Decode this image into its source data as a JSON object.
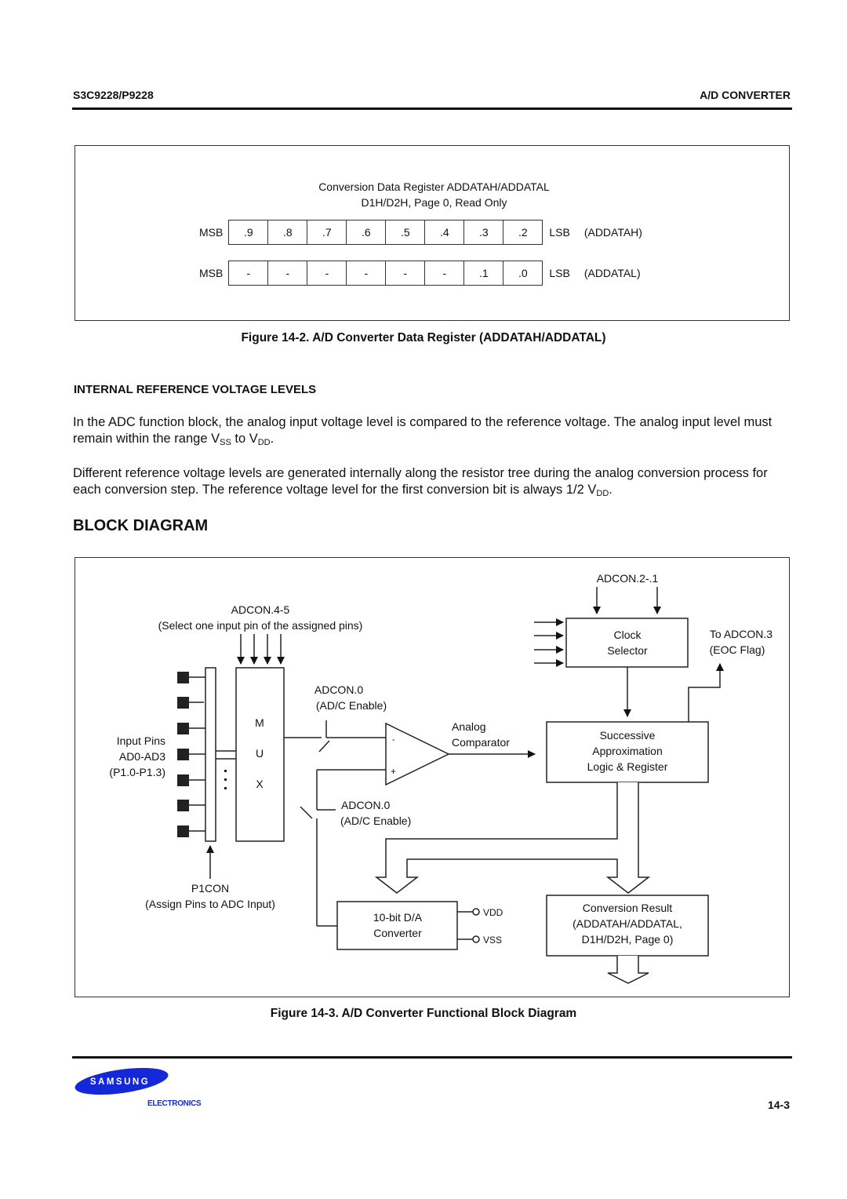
{
  "header": {
    "left": "S3C9228/P9228",
    "right": "A/D CONVERTER"
  },
  "figure_14_2": {
    "title_line1": "Conversion Data Register ADDATAH/ADDATAL",
    "title_line2": "D1H/D2H, Page 0, Read Only",
    "rows": [
      {
        "msb": "MSB",
        "bits": [
          ".9",
          ".8",
          ".7",
          ".6",
          ".5",
          ".4",
          ".3",
          ".2"
        ],
        "lsb": "LSB",
        "name": "(ADDATAH)"
      },
      {
        "msb": "MSB",
        "bits": [
          "-",
          "-",
          "-",
          "-",
          "-",
          "-",
          ".1",
          ".0"
        ],
        "lsb": "LSB",
        "name": "(ADDATAL)"
      }
    ],
    "caption": "Figure 14-2. A/D Converter Data Register (ADDATAH/ADDATAL)"
  },
  "section_ref": {
    "heading": "INTERNAL REFERENCE VOLTAGE LEVELS",
    "para1_text": "In the ADC function block, the analog input voltage level is compared to the reference voltage. The analog input level must remain within the range V",
    "para1_sub1": "SS",
    "para1_mid": " to V",
    "para1_sub2": "DD",
    "para1_end": ".",
    "para2_text": "Different reference voltage levels are generated internally along the resistor tree during the analog conversion process for each conversion step. The reference voltage level for the first conversion bit is always 1/2 V",
    "para2_sub": "DD",
    "para2_end": "."
  },
  "block_diagram": {
    "heading": "BLOCK DIAGRAM",
    "labels": {
      "adcon45": "ADCON.4-5",
      "adcon45_desc": "(Select one input pin of the assigned pins)",
      "adcon21": "ADCON.2-.1",
      "clock_selector_1": "Clock",
      "clock_selector_2": "Selector",
      "to_adcon3": "To ADCON.3",
      "eoc_flag": "(EOC Flag)",
      "adcon0_top": "ADCON.0",
      "adc_enable_top": "(AD/C Enable)",
      "mux_m": "M",
      "mux_u": "U",
      "mux_x": "X",
      "input_pins_1": "Input Pins",
      "input_pins_2": "AD0-AD3",
      "input_pins_3": "(P1.0-P1.3)",
      "analog": "Analog",
      "comparator": "Comparator",
      "minus": "-",
      "plus": "+",
      "sar_1": "Successive",
      "sar_2": "Approximation",
      "sar_3": "Logic & Register",
      "adcon0_bottom": "ADCON.0",
      "adc_enable_bottom": "(AD/C Enable)",
      "p1con": "P1CON",
      "p1con_desc": "(Assign Pins to ADC Input)",
      "dac_1": "10-bit D/A",
      "dac_2": "Converter",
      "vdd": "VDD",
      "vss": "VSS",
      "result_1": "Conversion Result",
      "result_2": "(ADDATAH/ADDATAL,",
      "result_3": "D1H/D2H, Page 0)"
    },
    "caption": "Figure 14-3. A/D Converter Functional Block Diagram"
  },
  "footer": {
    "logo_text": "SAMSUNG",
    "logo_sub": "ELECTRONICS",
    "page_number": "14-3",
    "brand_color": "#1428d8"
  }
}
